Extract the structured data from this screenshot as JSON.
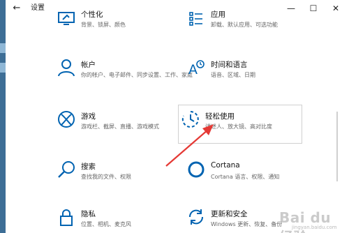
{
  "window": {
    "title": "设置",
    "back_label": "←",
    "minimize": "—",
    "maximize": "☐",
    "close": "✕"
  },
  "tiles": {
    "personalization": {
      "title": "个性化",
      "desc": "背景、锁屏、颜色"
    },
    "devices_top": {
      "title": "应用",
      "desc": "卸载、默认应用、可选功能"
    },
    "accounts": {
      "title": "帐户",
      "desc": "你的帐户、电子邮件、同步设置、工作、家庭"
    },
    "time_language": {
      "title": "时间和语言",
      "desc": "语音、区域、日期"
    },
    "gaming": {
      "title": "游戏",
      "desc": "游戏栏、截屏、直播、游戏模式"
    },
    "ease_of_access": {
      "title": "轻松使用",
      "desc": "讲述人、放大镜、高对比度"
    },
    "search": {
      "title": "搜索",
      "desc": "查找我的文件、权限"
    },
    "cortana": {
      "title": "Cortana",
      "desc": "Cortana 语言、权限、通知"
    },
    "privacy": {
      "title": "隐私",
      "desc": "位置、相机、麦克风"
    },
    "update_security": {
      "title": "更新和安全",
      "desc": "Windows 更新、恢复、备份"
    }
  },
  "watermark": {
    "text": "Bai du 经验",
    "sub": "jingyan.baidu.com"
  },
  "colors": {
    "accent": "#0063b1",
    "arrow": "#e53935"
  }
}
